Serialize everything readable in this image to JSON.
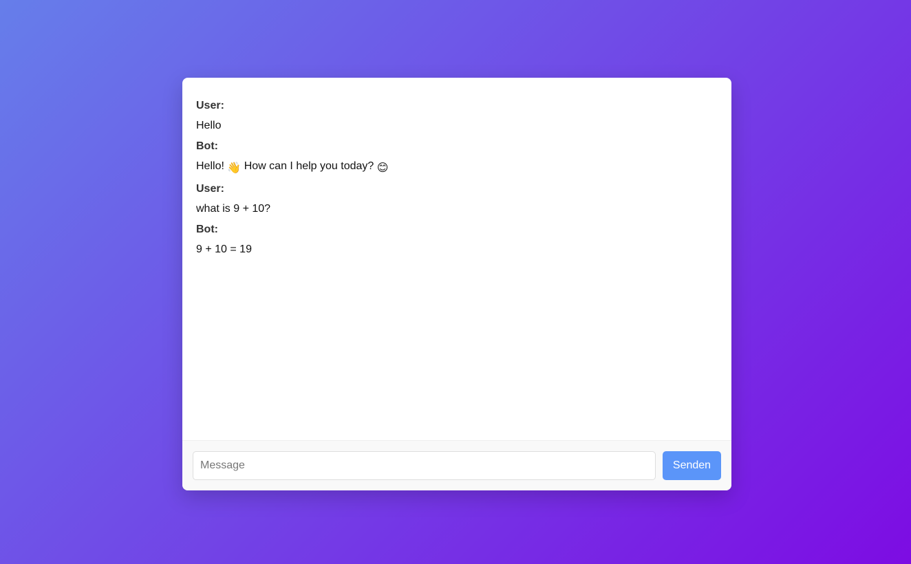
{
  "messages": [
    {
      "sender": "User:",
      "text": "Hello"
    },
    {
      "sender": "Bot:",
      "text_before": "Hello! ",
      "emoji1": "👋",
      "text_middle": " How can I help you today? ",
      "emoji2": "😊"
    },
    {
      "sender": "User:",
      "text": "what is 9 + 10?"
    },
    {
      "sender": "Bot:",
      "text": "9 + 10 = 19"
    }
  ],
  "composer": {
    "placeholder": "Message",
    "send_label": "Senden"
  },
  "colors": {
    "gradient_start": "#667eea",
    "gradient_end": "#7d0ce3",
    "send_button": "#5b95f9"
  }
}
